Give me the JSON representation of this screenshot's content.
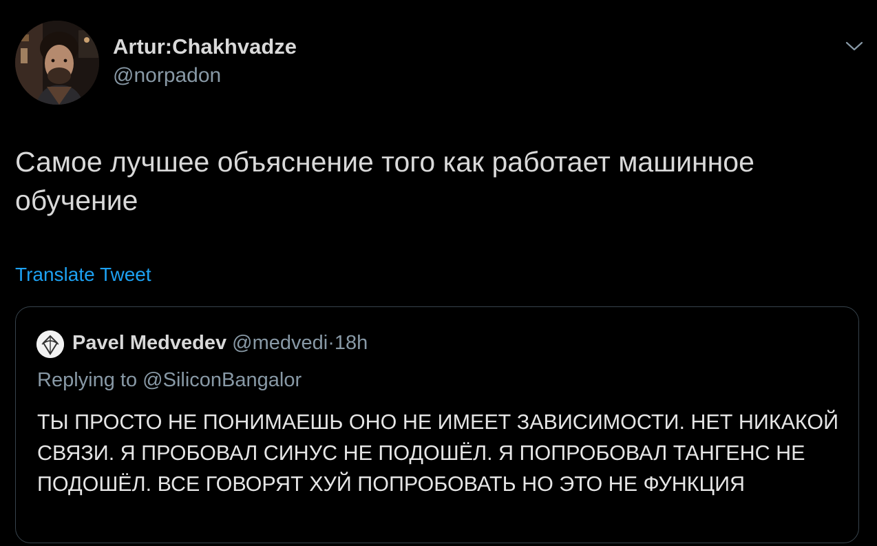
{
  "author": {
    "name": "Artur:Chakhvadze",
    "handle": "@norpadon"
  },
  "tweet": {
    "text": "Самое лучшее объяснение того как работает машинное обучение",
    "translate_label": "Translate Tweet"
  },
  "quoted_tweet": {
    "author_name": "Pavel Medvedev",
    "author_handle": "@medvedi",
    "separator": "·",
    "time": "18h",
    "replying_prefix": "Replying to",
    "replying_to": "@SiliconBangalor",
    "text": "ТЫ ПРОСТО НЕ ПОНИМАЕШЬ ОНО НЕ ИМЕЕТ ЗАВИСИМОСТИ. НЕТ НИКАКОЙ СВЯЗИ. Я ПРОБОВАЛ СИНУС НЕ ПОДОШЁЛ. Я ПОПРОБОВАЛ ТАНГЕНС НЕ ПОДОШЁЛ. ВСЕ ГОВОРЯТ ХУЙ ПОПРОБОВАТЬ НО ЭТО НЕ ФУНКЦИЯ"
  },
  "icons": {
    "menu": "chevron-down-icon"
  },
  "colors": {
    "background": "#000000",
    "text": "#d9d9d9",
    "secondary": "#8899a6",
    "link": "#1da1f2",
    "border": "#38444d"
  }
}
